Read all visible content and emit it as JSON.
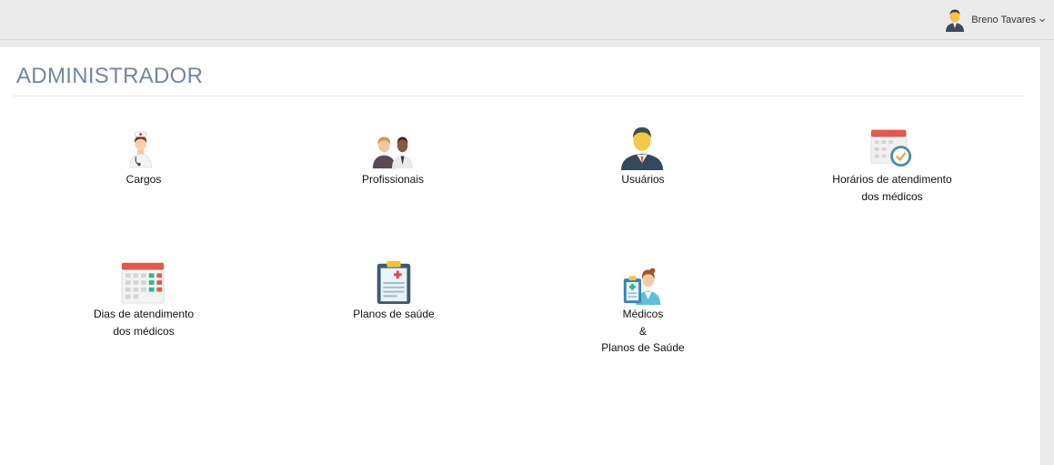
{
  "header": {
    "user_name": "Breno Tavares"
  },
  "page": {
    "title": "ADMINISTRADOR"
  },
  "tiles": [
    {
      "label": "Cargos",
      "icon": "nurse-icon"
    },
    {
      "label": "Profissionais",
      "icon": "professionals-icon"
    },
    {
      "label": "Usuários",
      "icon": "user-icon"
    },
    {
      "label": "Horários de atendimento\ndos médicos",
      "icon": "calendar-clock-icon"
    },
    {
      "label": "Dias de atendimento\ndos médicos",
      "icon": "calendar-icon"
    },
    {
      "label": "Planos de saúde",
      "icon": "clipboard-medical-icon"
    },
    {
      "label": "Médicos\n&\nPlanos de Saúde",
      "icon": "doctor-clipboard-icon"
    }
  ],
  "colors": {
    "title": "#73879c",
    "background": "#ebebeb",
    "panel": "#ffffff"
  }
}
